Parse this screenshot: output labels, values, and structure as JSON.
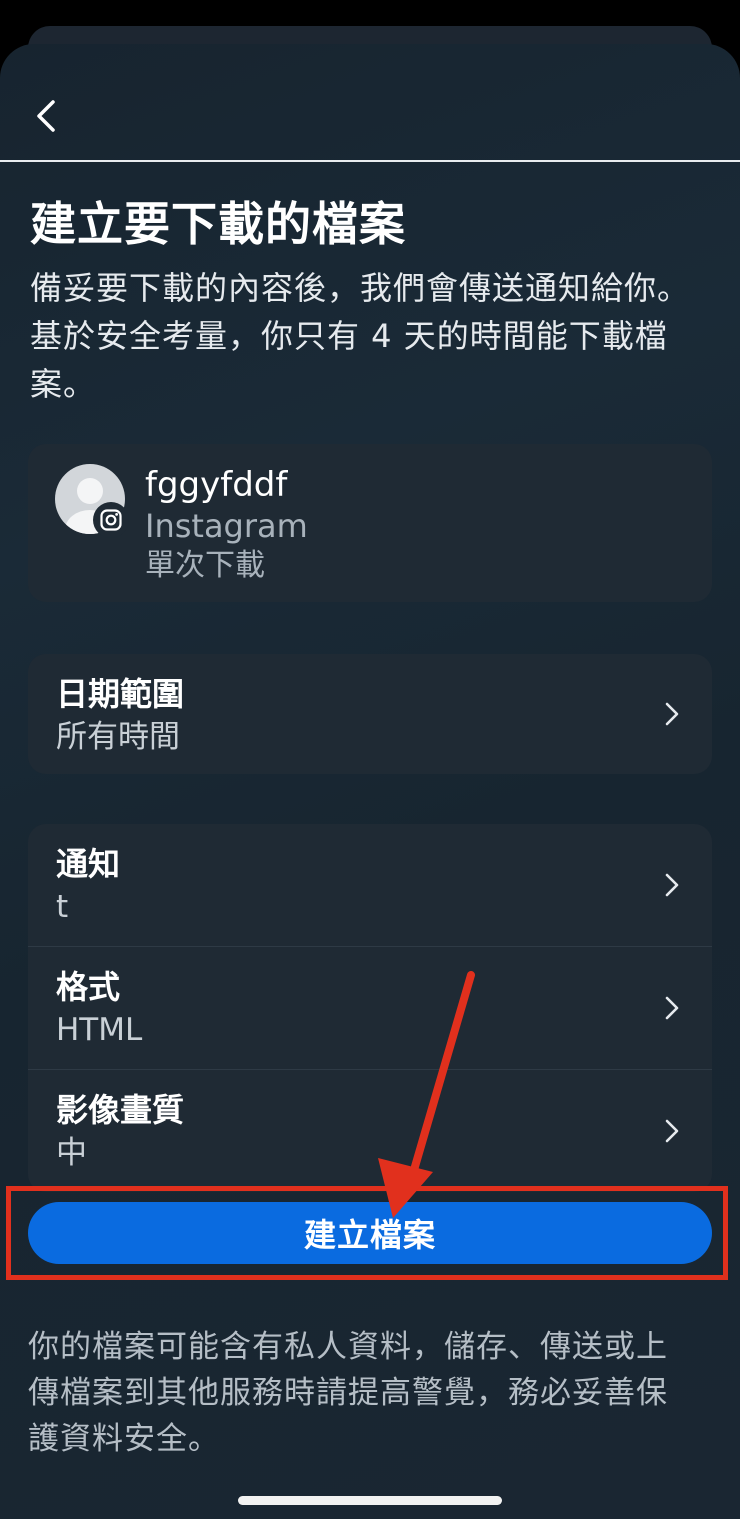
{
  "header": {
    "title": "建立要下載的檔案",
    "description": "備妥要下載的內容後，我們會傳送通知給你。基於安全考量，你只有 4 天的時間能下載檔案。"
  },
  "account": {
    "username": "fggyfddf",
    "platform": "Instagram",
    "download_type": "單次下載"
  },
  "date_range": {
    "label": "日期範圍",
    "value": "所有時間"
  },
  "settings": [
    {
      "label": "通知",
      "value": "t"
    },
    {
      "label": "格式",
      "value": "HTML"
    },
    {
      "label": "影像畫質",
      "value": "中"
    }
  ],
  "primary_button": {
    "label": "建立檔案"
  },
  "footer_note": "你的檔案可能含有私人資料，儲存、傳送或上傳檔案到其他服務時請提高警覺，務必妥善保護資料安全。",
  "colors": {
    "accent": "#0a6be0",
    "annotation": "#e1301d",
    "card": "#1f2a34"
  },
  "icons": {
    "back": "chevron-left-icon",
    "instagram": "instagram-icon",
    "row": "chevron-right-icon"
  }
}
